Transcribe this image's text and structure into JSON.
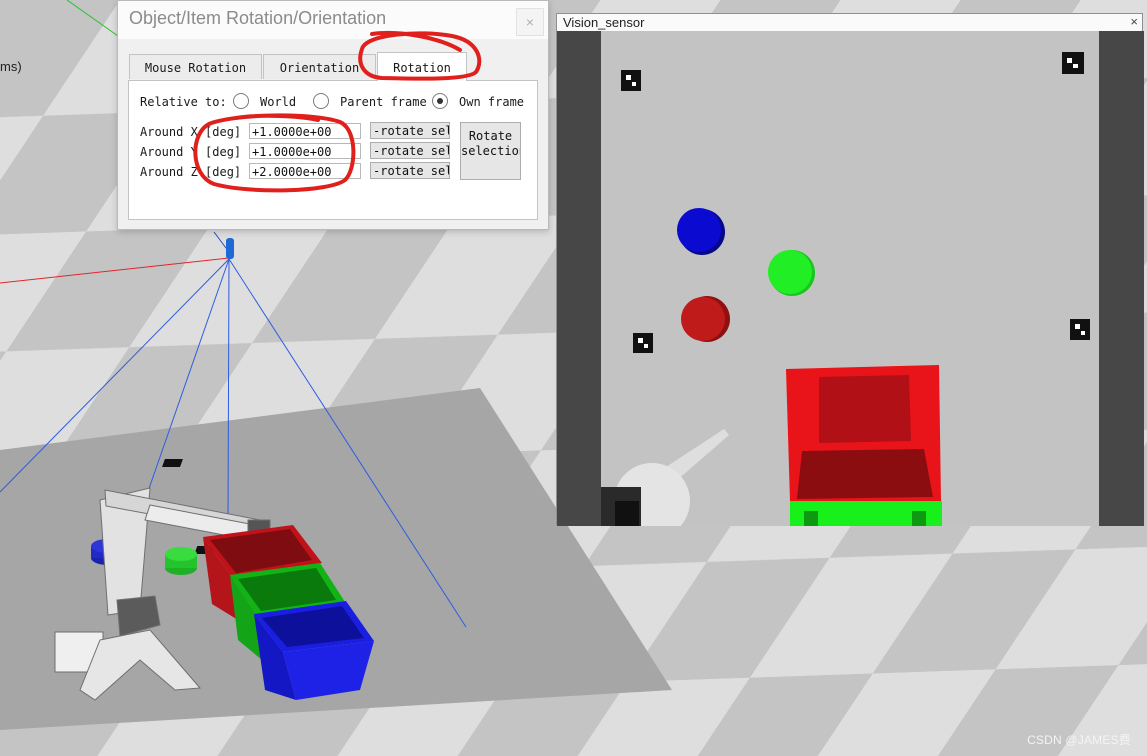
{
  "scene": {
    "partial_label": "ms)",
    "watermark": "CSDN @JAMES费"
  },
  "dialog": {
    "title": "Object/Item Rotation/Orientation",
    "close_glyph": "×",
    "tabs": [
      {
        "label": "Mouse Rotation",
        "active": false
      },
      {
        "label": "Orientation",
        "active": false
      },
      {
        "label": "Rotation",
        "active": true
      }
    ],
    "relative_to": {
      "label": "Relative to:",
      "options": [
        {
          "label": "World",
          "checked": false
        },
        {
          "label": "Parent frame",
          "checked": false
        },
        {
          "label": "Own frame",
          "checked": true
        }
      ]
    },
    "axes": [
      {
        "label": "Around X [deg]",
        "value": "+1.0000e+00",
        "button": "-rotate sel"
      },
      {
        "label": "Around Y [deg]",
        "value": "+1.0000e+00",
        "button": "-rotate sel"
      },
      {
        "label": "Around Z [deg]",
        "value": "+2.0000e+00",
        "button": "-rotate sel"
      }
    ],
    "rotate_selection": {
      "line1": "Rotate",
      "line2": "selection"
    }
  },
  "vision_sensor": {
    "title": "Vision_sensor",
    "close_glyph": "×"
  },
  "colors": {
    "annotation": "#e0201c",
    "cube_red": "#e8141c",
    "cube_green": "#18e51c",
    "cube_blue": "#0c14e0",
    "floor_light": "#d8d8d8",
    "floor_dark": "#a9a9a9"
  }
}
